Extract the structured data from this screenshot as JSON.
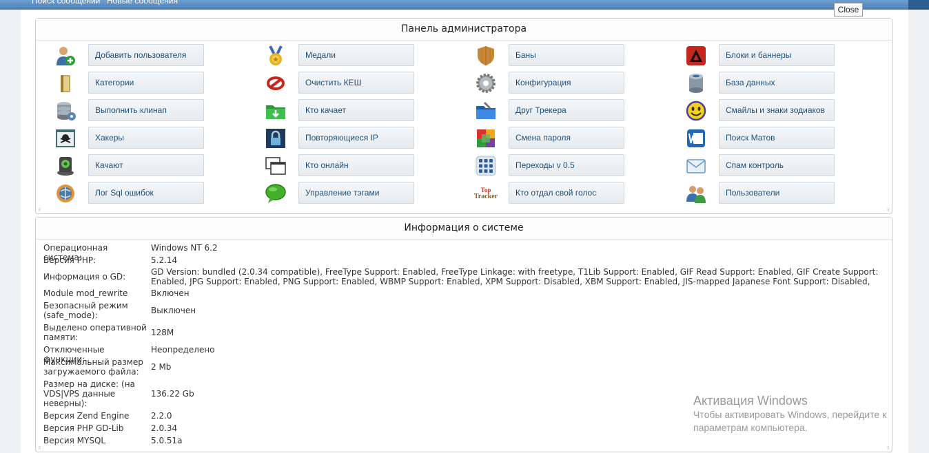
{
  "topnav": {
    "search_link": "Поиск сообщений",
    "new_link": "Новые сообщения"
  },
  "close_label": "Close",
  "admin_panel": {
    "title": "Панель администратора",
    "columns": [
      [
        {
          "label": "Добавить пользователя",
          "icon": "add-user-icon"
        },
        {
          "label": "Категории",
          "icon": "folder-icon"
        },
        {
          "label": "Выполнить клинап",
          "icon": "database-clean-icon"
        },
        {
          "label": "Хакеры",
          "icon": "skull-icon"
        },
        {
          "label": "Качают",
          "icon": "download-disk-icon"
        },
        {
          "label": "Лог Sql ошибок",
          "icon": "globe-log-icon"
        }
      ],
      [
        {
          "label": "Медали",
          "icon": "medal-icon"
        },
        {
          "label": "Очистить КЕШ",
          "icon": "no-entry-icon"
        },
        {
          "label": "Кто качает",
          "icon": "green-folder-download-icon"
        },
        {
          "label": "Повторяющиеся IP",
          "icon": "lock-icon"
        },
        {
          "label": "Кто онлайн",
          "icon": "windows-icon"
        },
        {
          "label": "Управление тэгами",
          "icon": "speech-bubble-icon"
        }
      ],
      [
        {
          "label": "Баны",
          "icon": "shield-icon"
        },
        {
          "label": "Конфигурация",
          "icon": "gear-icon"
        },
        {
          "label": "Друг Трекера",
          "icon": "blue-folder-icon"
        },
        {
          "label": "Смена пароля",
          "icon": "colored-blocks-icon"
        },
        {
          "label": "Переходы v 0.5",
          "icon": "apps-grid-icon"
        },
        {
          "label": "Кто отдал свой голос",
          "icon": "top-tracker-logo-icon"
        }
      ],
      [
        {
          "label": "Блоки и баннеры",
          "icon": "adobe-blocks-icon"
        },
        {
          "label": "База данных",
          "icon": "database-icon"
        },
        {
          "label": "Смайлы и знаки зодиаков",
          "icon": "smiley-icon"
        },
        {
          "label": "Поиск Матов",
          "icon": "word-icon"
        },
        {
          "label": "Спам контроль",
          "icon": "mail-icon"
        },
        {
          "label": "Пользователи",
          "icon": "users-icon"
        }
      ]
    ],
    "top_tracker_logo": {
      "line1": "Top",
      "line2": "Tracker"
    }
  },
  "system_info": {
    "title": "Информация о системе",
    "rows": [
      {
        "label": "Операционная система:",
        "value": "Windows NT 6.2"
      },
      {
        "label": "Версия PHP:",
        "value": "5.2.14"
      },
      {
        "label": "Информация о GD:",
        "value": "GD Version: bundled (2.0.34 compatible), FreeType Support: Enabled, FreeType Linkage: with freetype, T1Lib Support: Enabled, GIF Read Support: Enabled, GIF Create Support: Enabled, JPG Support: Enabled, PNG Support: Enabled, WBMP Support: Enabled, XPM Support: Disabled, XBM Support: Enabled, JIS-mapped Japanese Font Support: Disabled,"
      },
      {
        "label": "Module mod_rewrite",
        "value": "Включен"
      },
      {
        "label": "Безопасный режим (safe_mode):",
        "value": "Выключен"
      },
      {
        "label": "Выделено оперативной памяти:",
        "value": "128M"
      },
      {
        "label": "Отключенные функции:",
        "value": "Неопределено"
      },
      {
        "label": "Максимальный размер загружаемого файла:",
        "value": "2 Mb"
      },
      {
        "label": "Размер на диске: (на VDS|VPS данные неверны):",
        "value": "136.22 Gb"
      },
      {
        "label": "Версия Zend Engine",
        "value": "2.2.0"
      },
      {
        "label": "Версия PHP GD-Lib",
        "value": "2.0.34"
      },
      {
        "label": "Версия MYSQL",
        "value": "5.0.51a"
      }
    ]
  },
  "watermark": {
    "title": "Активация Windows",
    "subtitle": "Чтобы активировать Windows, перейдите к параметрам компьютера."
  }
}
